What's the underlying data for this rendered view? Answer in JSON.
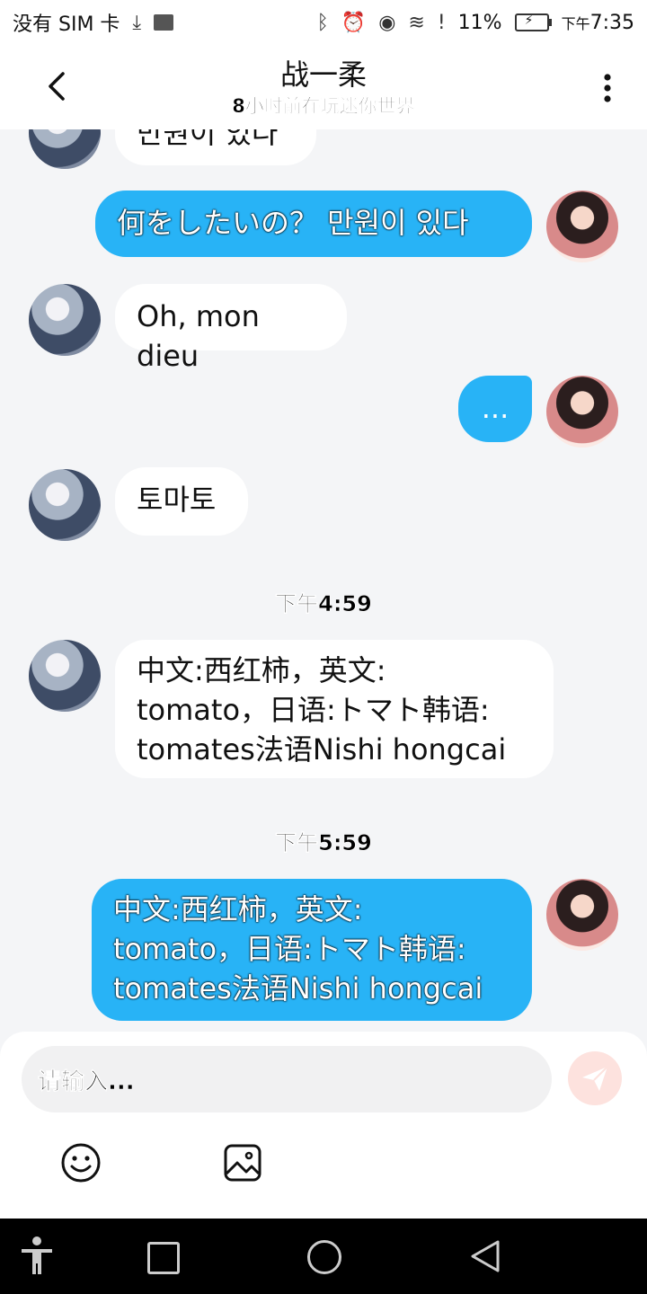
{
  "status_bar": {
    "carrier": "没有 SIM 卡",
    "battery": "11%",
    "time_prefix": "下午",
    "time": "7:35"
  },
  "header": {
    "title": "战一柔",
    "subtitle": "8小时前在玩迷你世界"
  },
  "messages": [
    {
      "side": "in",
      "text": "만원이 있다"
    },
    {
      "side": "out",
      "text": "何をしたいの？ 만원이 있다"
    },
    {
      "side": "in",
      "text": "Oh, mon dieu"
    },
    {
      "side": "out",
      "text": "..."
    },
    {
      "side": "in",
      "text": "토마토"
    },
    {
      "side": "time",
      "text": "下午4:59"
    },
    {
      "side": "in",
      "text": "中文:西红柿，英文:\ntomato，日语:トマト韩语:\ntomates法语Nishi hongcai"
    },
    {
      "side": "time",
      "text": "下午5:59"
    },
    {
      "side": "out",
      "text": "中文:西红柿，英文:\ntomato，日语:トマト韩语:\ntomates法语Nishi hongcai"
    }
  ],
  "input": {
    "placeholder": "请输入..."
  },
  "colors": {
    "outgoing_bubble": "#28b3f6",
    "incoming_bubble": "#ffffff",
    "chat_background": "#f4f5f7",
    "send_button": "#fde2de"
  },
  "icons": [
    "back-arrow-icon",
    "more-vertical-icon",
    "send-icon",
    "emoji-icon",
    "image-icon",
    "accessibility-icon",
    "recents-icon",
    "home-icon",
    "back-triangle-icon",
    "download-icon",
    "gallery-icon",
    "bluetooth-icon",
    "alarm-icon",
    "eye-icon",
    "wifi-icon",
    "alert-icon",
    "battery-icon"
  ]
}
